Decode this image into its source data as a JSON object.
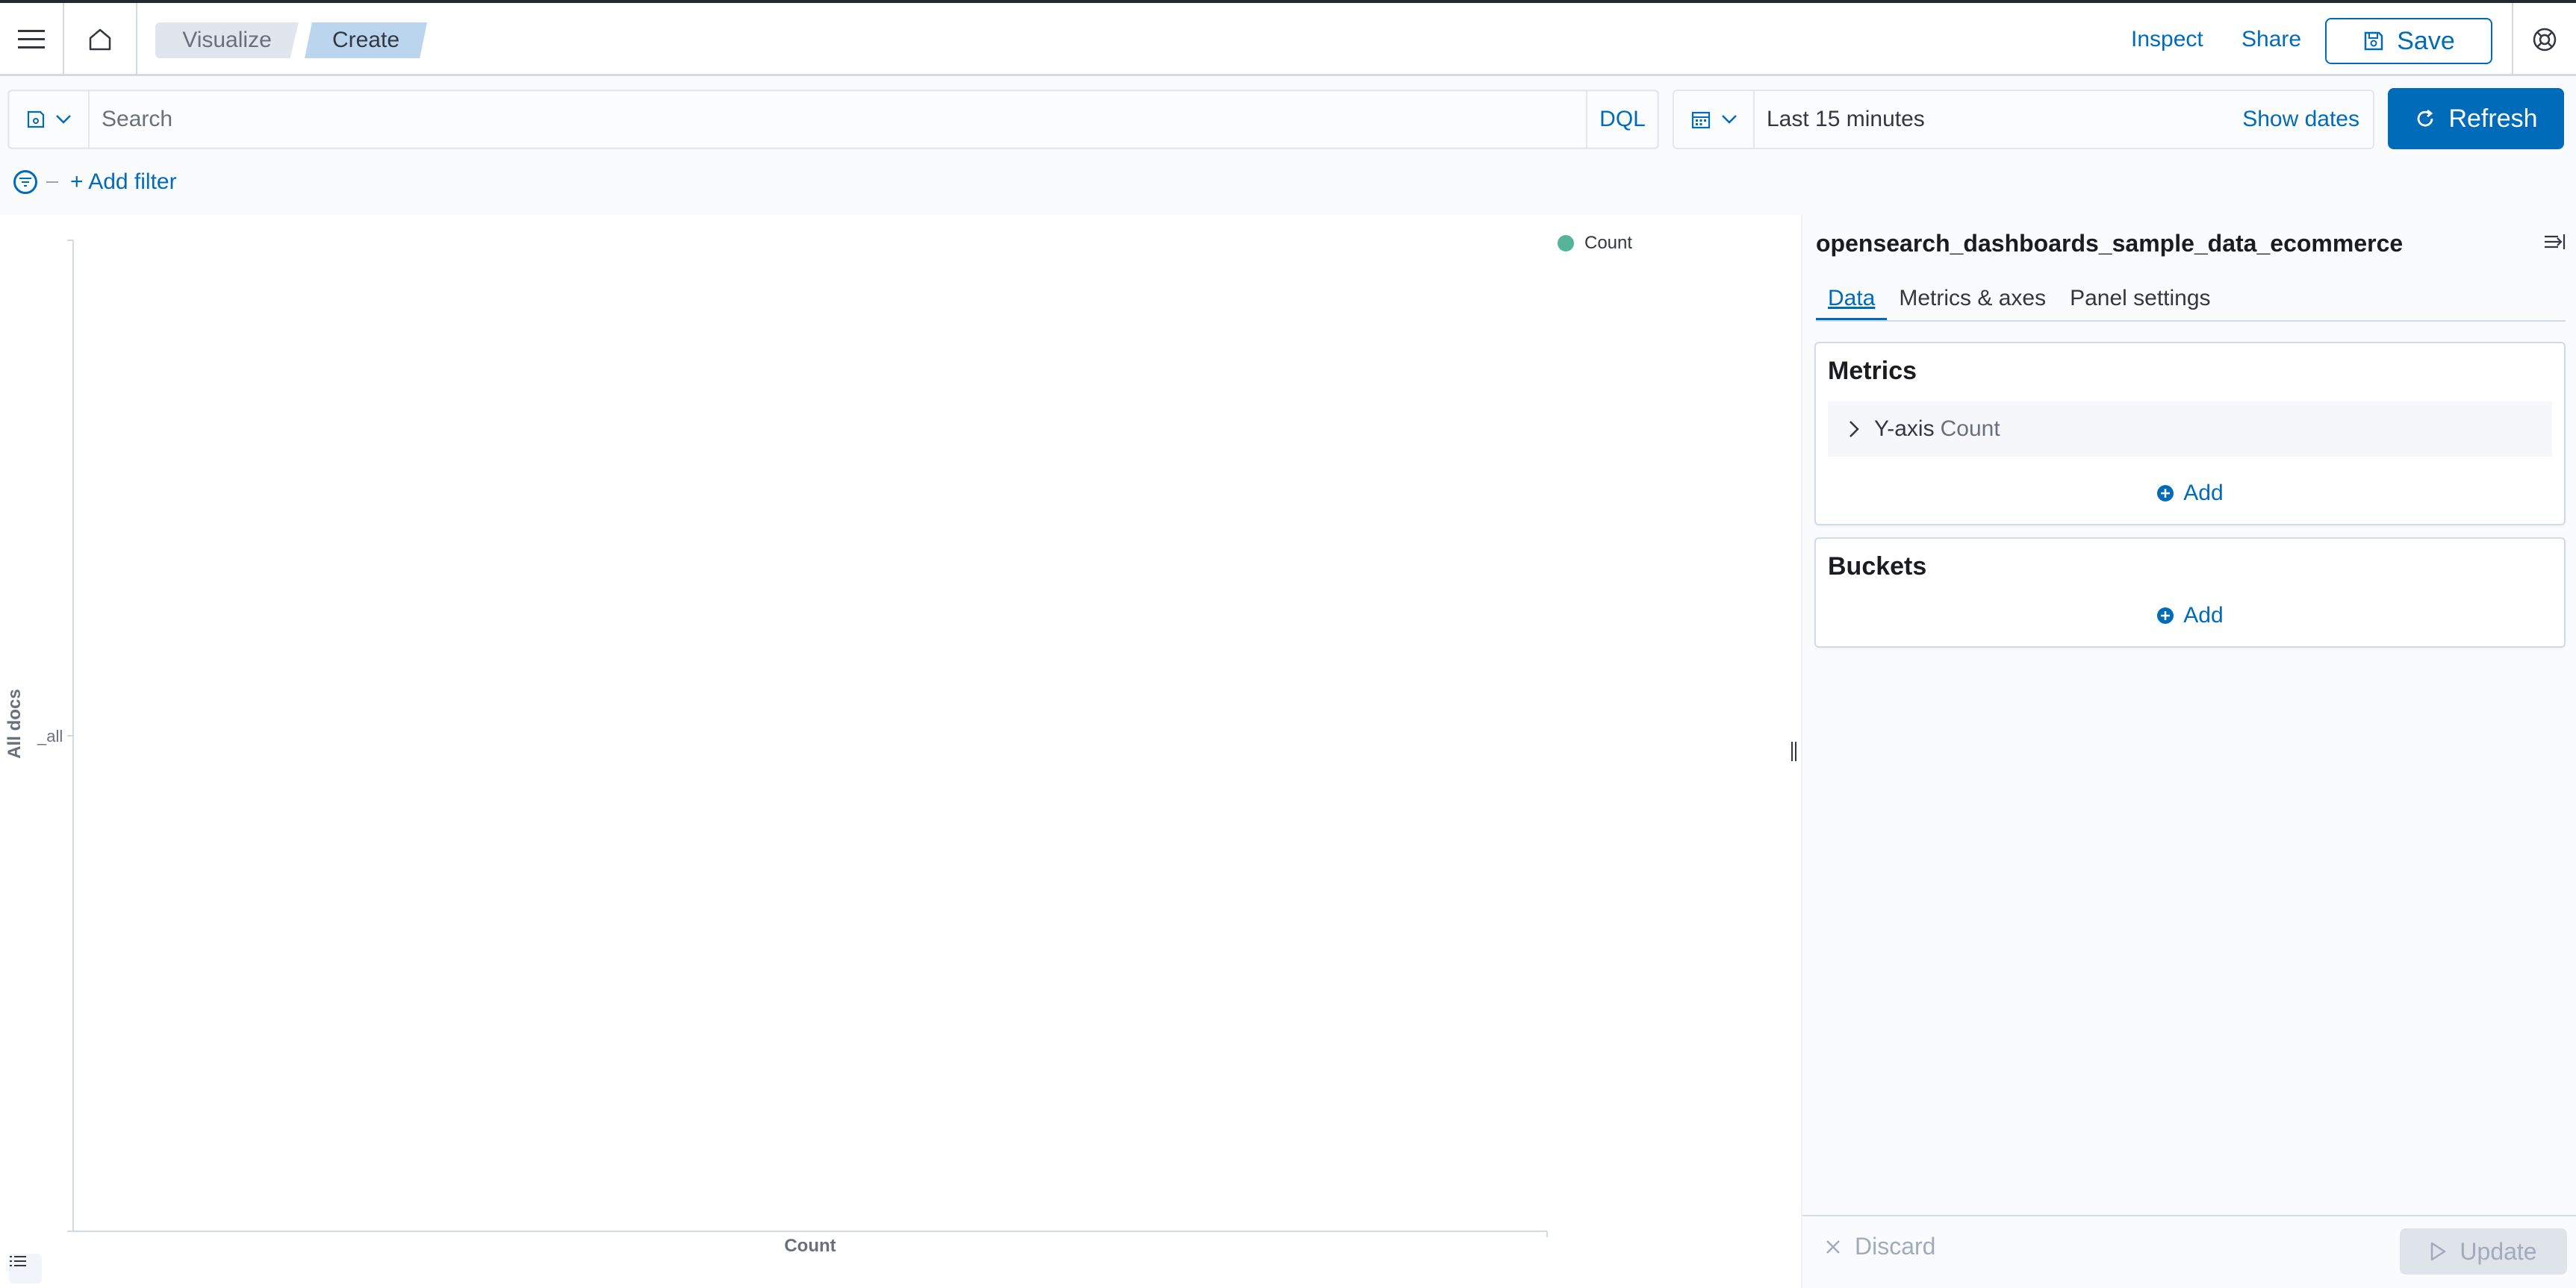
{
  "header": {
    "breadcrumbs": [
      {
        "label": "Visualize"
      },
      {
        "label": "Create"
      }
    ],
    "inspect_label": "Inspect",
    "share_label": "Share",
    "save_label": "Save"
  },
  "query": {
    "search_placeholder": "Search",
    "language": "DQL",
    "time_range": "Last 15 minutes",
    "show_dates_label": "Show dates",
    "refresh_label": "Refresh",
    "add_filter_label": "+ Add filter"
  },
  "chart_data": {
    "type": "bar",
    "categories": [
      "_all"
    ],
    "series": [
      {
        "name": "Count",
        "values": []
      }
    ],
    "xlabel": "Count",
    "ylabel": "All docs",
    "legend_position": "top-right",
    "colors": {
      "Count": "#54b399"
    },
    "grid": false
  },
  "sidebar": {
    "index_pattern": "opensearch_dashboards_sample_data_ecommerce",
    "tabs": [
      {
        "label": "Data",
        "active": true
      },
      {
        "label": "Metrics & axes"
      },
      {
        "label": "Panel settings"
      }
    ],
    "metrics": {
      "title": "Metrics",
      "items": [
        {
          "name": "Y-axis",
          "value": "Count"
        }
      ],
      "add_label": "Add"
    },
    "buckets": {
      "title": "Buckets",
      "add_label": "Add"
    },
    "discard_label": "Discard",
    "update_label": "Update"
  },
  "colors": {
    "primary": "#006bb8",
    "series_count": "#54b399",
    "border": "#d3dae6"
  }
}
